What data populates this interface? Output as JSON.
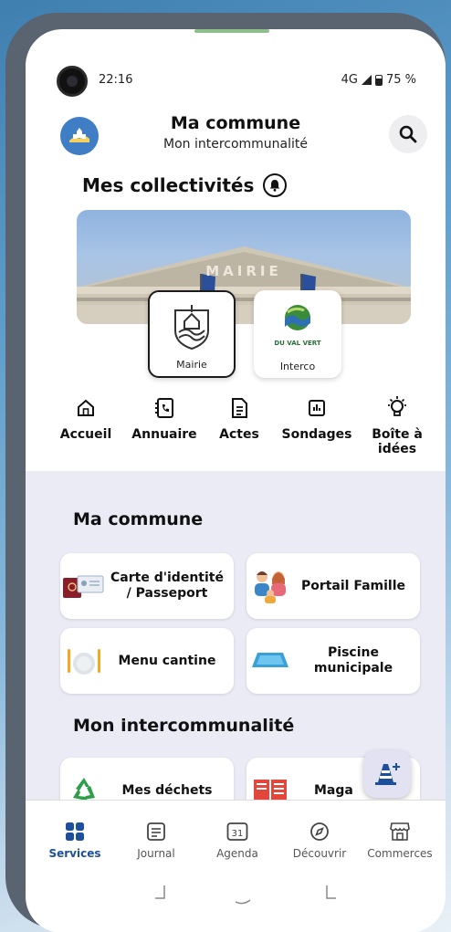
{
  "status_bar": {
    "time": "22:16",
    "network": "4G",
    "battery": "75 %"
  },
  "header": {
    "title": "Ma commune",
    "subtitle": "Mon intercommunalité"
  },
  "collectivites": {
    "heading": "Mes collectivités",
    "banner_text": "MAIRIE",
    "cards": [
      {
        "label": "Mairie",
        "active": true
      },
      {
        "label": "Interco",
        "active": false,
        "logo_text": "DU VAL VERT"
      }
    ]
  },
  "quick_nav": [
    {
      "label": "Accueil",
      "icon": "home-icon"
    },
    {
      "label": "Annuaire",
      "icon": "phone-book-icon"
    },
    {
      "label": "Actes",
      "icon": "document-icon"
    },
    {
      "label": "Sondages",
      "icon": "poll-icon"
    },
    {
      "label": "Boîte à idées",
      "icon": "lightbulb-icon"
    }
  ],
  "ma_commune": {
    "heading": "Ma commune",
    "tiles": [
      {
        "label": "Carte d'identité / Passeport",
        "icon": "id-card-icon"
      },
      {
        "label": "Portail Famille",
        "icon": "family-icon"
      },
      {
        "label": "Menu cantine",
        "icon": "plate-icon"
      },
      {
        "label": "Piscine municipale",
        "icon": "pool-icon"
      }
    ]
  },
  "intercommunalite": {
    "heading": "Mon intercommunalité",
    "tiles": [
      {
        "label": "Mes déchets",
        "icon": "recycle-icon"
      },
      {
        "label": "Maga",
        "icon": "magazine-icon"
      }
    ]
  },
  "bottom_nav": [
    {
      "label": "Services",
      "active": true
    },
    {
      "label": "Journal",
      "active": false
    },
    {
      "label": "Agenda",
      "active": false,
      "icon_text": "31"
    },
    {
      "label": "Découvrir",
      "active": false
    },
    {
      "label": "Commerces",
      "active": false
    }
  ],
  "colors": {
    "accent": "#1d4f9c",
    "section_bg": "#ebebf5",
    "logo_bg": "#3f7dc4"
  }
}
